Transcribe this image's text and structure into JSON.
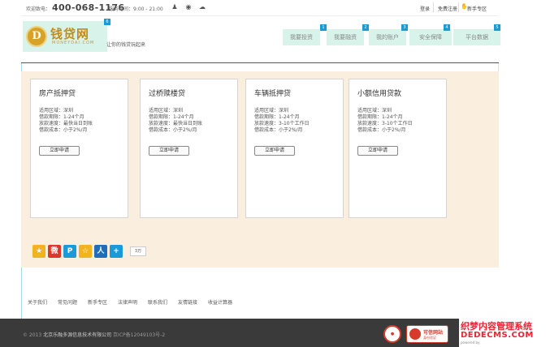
{
  "topbar": {
    "welcome": "欢迎致电：",
    "phone": "400-068-1176",
    "hours": "服务时间：9:00 - 21:00",
    "login": "登录",
    "register": "免费注册",
    "newbie": "新手专区"
  },
  "header": {
    "logo_text": "钱贷网",
    "logo_letter": "D",
    "logo_sub": "MONEYDAI.COM",
    "slogan": "让你的钱贷玩起来",
    "logo_badge": "6"
  },
  "nav": [
    {
      "label": "我要投资",
      "badge": "1"
    },
    {
      "label": "我要融资",
      "badge": "2"
    },
    {
      "label": "我的账户",
      "badge": "3"
    },
    {
      "label": "安全保障",
      "badge": "4"
    },
    {
      "label": "平台数据",
      "badge": "5"
    }
  ],
  "cards": [
    {
      "title": "房产抵押贷",
      "lines": [
        "适用区域：深圳",
        "借款期限：1-24个月",
        "放款速度：最快当日到账",
        "借款成本：小于2%/月"
      ],
      "button": "立即申请"
    },
    {
      "title": "过桥赎楼贷",
      "lines": [
        "适用区域：深圳",
        "借款期限：1-24个月",
        "放款速度：最快当日到账",
        "借款成本：小于2%/月"
      ],
      "button": "立即申请"
    },
    {
      "title": "车辆抵押贷",
      "lines": [
        "适用区域：深圳",
        "借款期限：1-24个月",
        "放款速度：3-10个工作日",
        "借款成本：小于2%/月"
      ],
      "button": "立即申请"
    },
    {
      "title": "小额信用贷款",
      "lines": [
        "适用区域：深圳",
        "借款期限：1-24个月",
        "放款速度：3-10个工作日",
        "借款成本：小于2%/月"
      ],
      "button": "立即申请"
    }
  ],
  "share": {
    "icons": [
      {
        "name": "qzone-icon",
        "color": "#f2b320",
        "glyph": "★"
      },
      {
        "name": "weibo-icon",
        "color": "#e0362a",
        "glyph": "微"
      },
      {
        "name": "pengyou-icon",
        "color": "#1a9ad6",
        "glyph": "P"
      },
      {
        "name": "qqstar-icon",
        "color": "#f2b320",
        "glyph": "☆"
      },
      {
        "name": "renren-icon",
        "color": "#1f6fb8",
        "glyph": "人"
      },
      {
        "name": "more-icon",
        "color": "#1a9ad6",
        "glyph": "+"
      }
    ],
    "count": "3万"
  },
  "footer_links": [
    "关于我们",
    "常见问题",
    "新手专区",
    "法律声明",
    "联系我们",
    "友情链接",
    "收益计算器"
  ],
  "footer": {
    "year": "© 2013",
    "company": "北京乐融多源信息技术有限公司",
    "icp": "京ICP备12049103号-2",
    "seal2_title": "可信网站",
    "seal2_sub": "身份验证"
  },
  "watermark": {
    "line1": "织梦内容管理系统",
    "line2": "DEDECMS.COM",
    "line3": "powered by"
  }
}
